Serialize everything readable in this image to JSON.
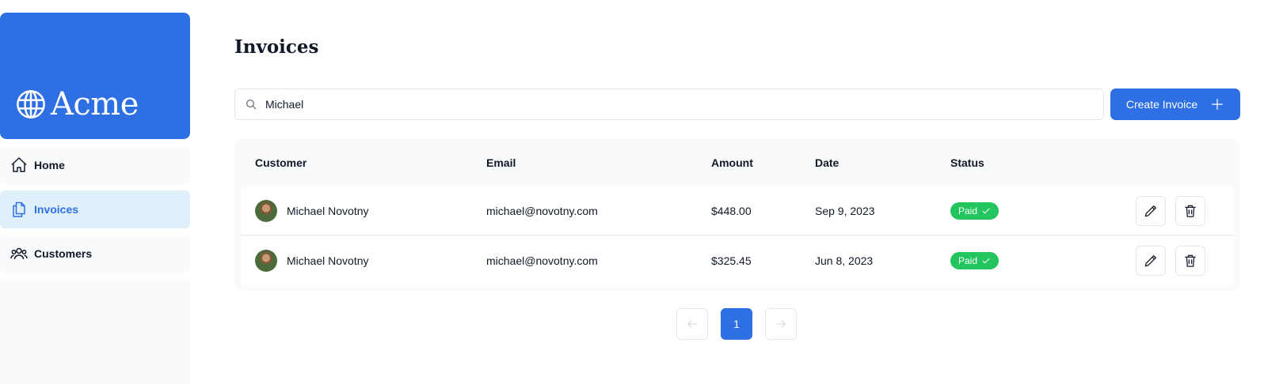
{
  "brand": {
    "name": "Acme",
    "color": "#2f6fe4",
    "icon": "globe-icon"
  },
  "sidebar": {
    "items": [
      {
        "label": "Home",
        "icon": "home-icon",
        "active": false
      },
      {
        "label": "Invoices",
        "icon": "document-duplicate-icon",
        "active": true
      },
      {
        "label": "Customers",
        "icon": "user-group-icon",
        "active": false
      }
    ]
  },
  "main": {
    "title": "Invoices",
    "search": {
      "value": "Michael",
      "icon": "search-icon"
    },
    "create_button": {
      "label": "Create Invoice",
      "icon": "plus-icon"
    },
    "table": {
      "columns": [
        "Customer",
        "Email",
        "Amount",
        "Date",
        "Status"
      ],
      "rows": [
        {
          "customer": "Michael Novotny",
          "email": "michael@novotny.com",
          "amount": "$448.00",
          "date": "Sep 9, 2023",
          "status": "Paid"
        },
        {
          "customer": "Michael Novotny",
          "email": "michael@novotny.com",
          "amount": "$325.45",
          "date": "Jun 8, 2023",
          "status": "Paid"
        }
      ]
    },
    "pagination": {
      "current_page": "1",
      "pages": [
        "1"
      ]
    }
  },
  "colors": {
    "primary": "#2f6fe4",
    "paid": "#22c55e",
    "active_nav_bg": "#e0f0fb",
    "panel_bg": "#f9fafb"
  }
}
